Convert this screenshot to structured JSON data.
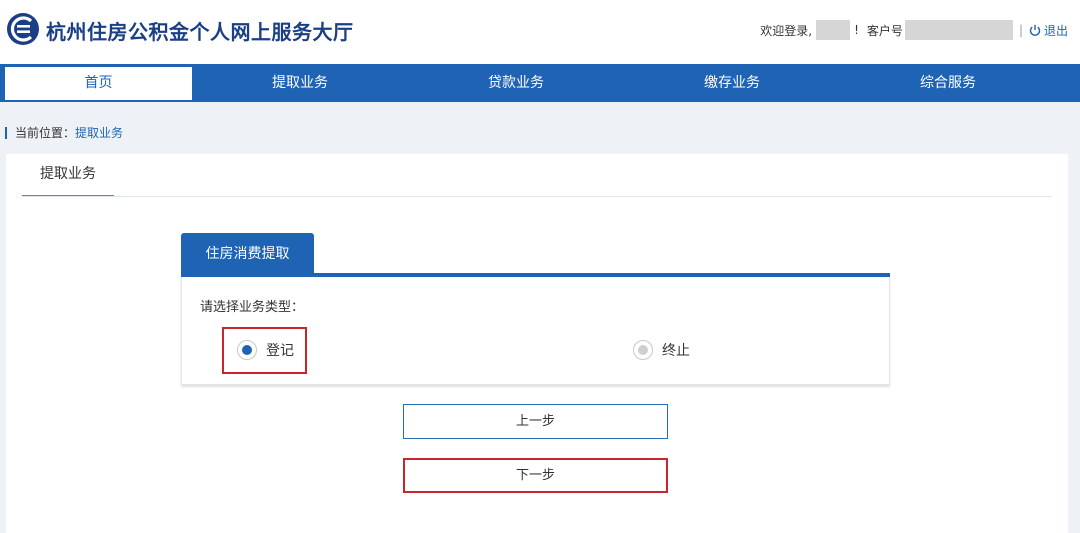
{
  "header": {
    "site_title": "杭州住房公积金个人网上服务大厅",
    "welcome_label": "欢迎登录,",
    "exclaim": "!",
    "customer_label": "客户号",
    "separator": "|",
    "logout_label": "退出",
    "logo_icon": "housing-fund-logo-icon",
    "logout_icon": "power-icon"
  },
  "nav": {
    "items": [
      {
        "label": "首页"
      },
      {
        "label": "提取业务"
      },
      {
        "label": "贷款业务"
      },
      {
        "label": "缴存业务"
      },
      {
        "label": "综合服务"
      }
    ],
    "active": "首页"
  },
  "breadcrumb": {
    "prefix": "当前位置：",
    "current": "提取业务"
  },
  "page_tab": {
    "label": "提取业务"
  },
  "form": {
    "tab_label": "住房消费提取",
    "type_label": "请选择业务类型：",
    "options": [
      {
        "label": "登记",
        "selected": true
      },
      {
        "label": "终止",
        "selected": false
      }
    ]
  },
  "buttons": {
    "prev_label": "上一步",
    "next_label": "下一步"
  },
  "colors": {
    "primary": "#1e63b4",
    "highlight": "#c8262d",
    "page_bg": "#eef1f6"
  }
}
